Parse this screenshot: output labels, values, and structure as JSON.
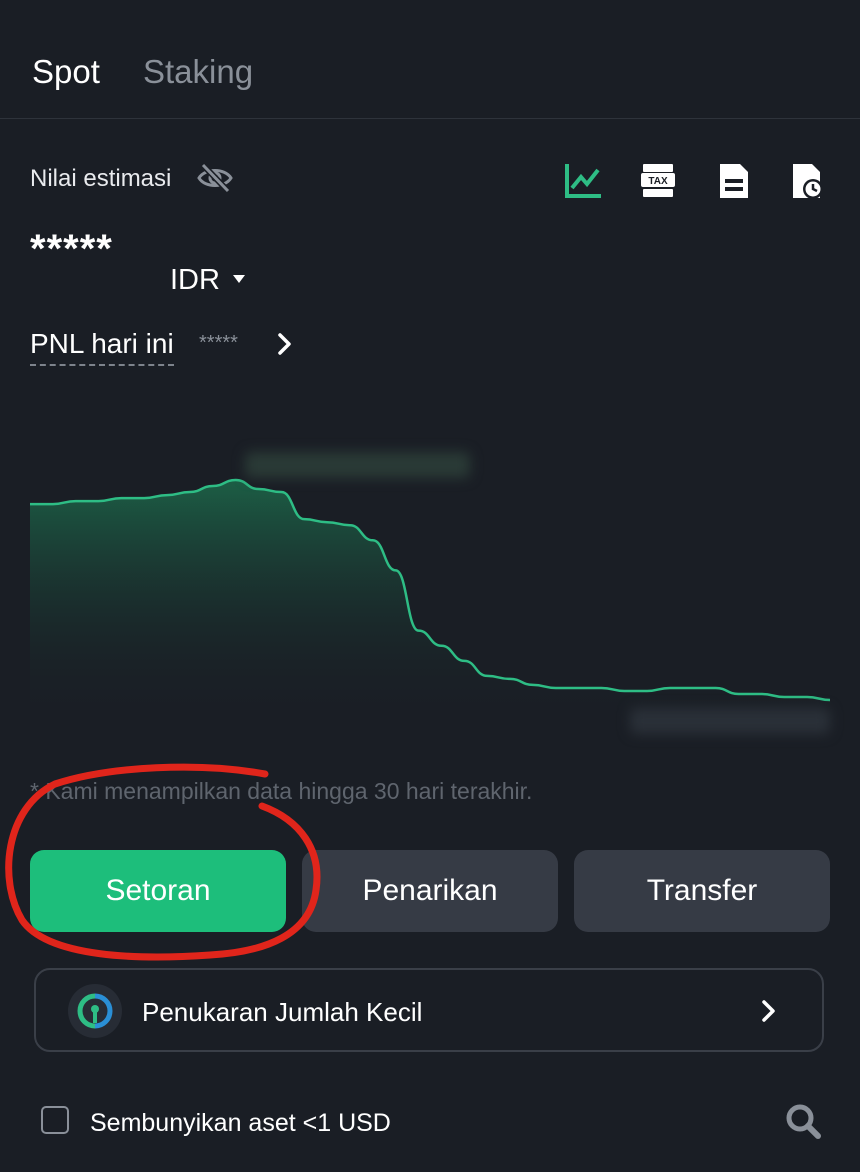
{
  "tabs": [
    {
      "label": "Spot",
      "active": true
    },
    {
      "label": "Staking",
      "active": false
    }
  ],
  "estimate": {
    "label": "Nilai estimasi",
    "hidden_icon": "eye-off-icon",
    "balance": "*****",
    "currency": "IDR"
  },
  "toolbar_icons": [
    "chart-icon",
    "tax-icon",
    "document-icon",
    "history-icon"
  ],
  "pnl": {
    "label": "PNL hari ini",
    "value": "*****"
  },
  "chart_data": {
    "type": "area",
    "color": "#2ebd85",
    "note": "* Kami menampilkan data hingga 30 hari terakhir.",
    "y": [
      82,
      82,
      83,
      83,
      84,
      84,
      85,
      86,
      88,
      90,
      87,
      86,
      77,
      76,
      75,
      70,
      60,
      40,
      35,
      30,
      25,
      24,
      22,
      21,
      21,
      21,
      20,
      20,
      21,
      21,
      21,
      19,
      19,
      18,
      18,
      17
    ]
  },
  "actions": {
    "deposit": "Setoran",
    "withdraw": "Penarikan",
    "transfer": "Transfer"
  },
  "dust": {
    "label": "Penukaran Jumlah Kecil"
  },
  "hide_small": {
    "label": "Sembunyikan aset <1 USD",
    "checked": false
  },
  "colors": {
    "accent": "#1dbe7b",
    "background": "#1a1e25",
    "annotation": "#e0251b"
  }
}
